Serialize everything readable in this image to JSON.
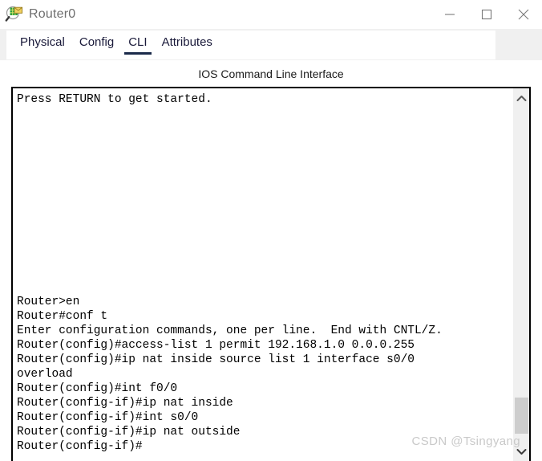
{
  "window": {
    "title": "Router0",
    "icon": "packet-tracer-router-icon",
    "controls": {
      "minimize": "minimize-icon",
      "maximize": "maximize-icon",
      "close": "close-icon"
    }
  },
  "tabs": [
    {
      "label": "Physical",
      "active": false
    },
    {
      "label": "Config",
      "active": false
    },
    {
      "label": "CLI",
      "active": true
    },
    {
      "label": "Attributes",
      "active": false
    }
  ],
  "panel": {
    "heading": "IOS Command Line Interface"
  },
  "terminal": {
    "lines": [
      "Press RETURN to get started.",
      "",
      "",
      "",
      "",
      "",
      "",
      "",
      "",
      "",
      "",
      "",
      "",
      "",
      "Router>en",
      "Router#conf t",
      "Enter configuration commands, one per line.  End with CNTL/Z.",
      "Router(config)#access-list 1 permit 192.168.1.0 0.0.0.255",
      "Router(config)#ip nat inside source list 1 interface s0/0",
      "overload",
      "Router(config)#int f0/0",
      "Router(config-if)#ip nat inside",
      "Router(config-if)#int s0/0",
      "Router(config-if)#ip nat outside",
      "Router(config-if)#"
    ]
  },
  "scrollbar": {
    "up_icon": "chevron-up-icon",
    "down_icon": "chevron-down-icon"
  },
  "watermark": {
    "text": "CSDN @Tsingyang"
  },
  "colors": {
    "accent": "#1b2a4a",
    "chrome": "#f0f0f0",
    "text": "#1a1a3a",
    "terminal_text": "#000000",
    "watermark": "#c9c9c9",
    "scroll_thumb": "#cdcdcd"
  }
}
